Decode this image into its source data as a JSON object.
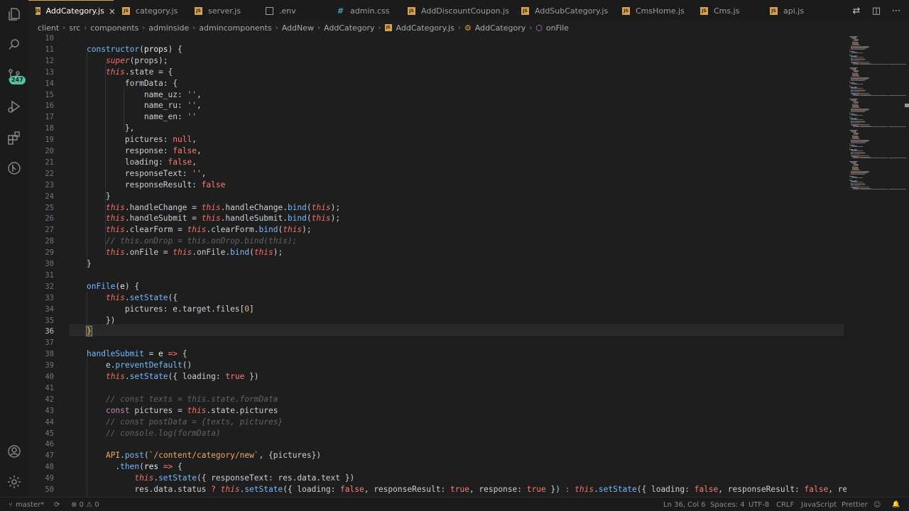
{
  "tabs": [
    {
      "label": "AddCategory.js",
      "type": "js",
      "active": true,
      "close": "×"
    },
    {
      "label": "category.js",
      "type": "js"
    },
    {
      "label": "server.js",
      "type": "js"
    },
    {
      "label": ".env",
      "type": "env"
    },
    {
      "label": "admin.css",
      "type": "css"
    },
    {
      "label": "AddDiscountCoupon.js",
      "type": "js"
    },
    {
      "label": "AddSubCategory.js",
      "type": "js"
    },
    {
      "label": "CmsHome.js",
      "type": "js"
    },
    {
      "label": "Cms.js",
      "type": "js"
    },
    {
      "label": "api.js",
      "type": "js"
    }
  ],
  "breadcrumb": [
    "client",
    "src",
    "components",
    "adminside",
    "admincomponents",
    "AddNew",
    "AddCategory",
    "AddCategory.js",
    "AddCategory",
    "onFile"
  ],
  "activity": {
    "scm_badge": "247"
  },
  "line_numbers": [
    "10",
    "11",
    "12",
    "13",
    "14",
    "15",
    "16",
    "17",
    "18",
    "19",
    "20",
    "21",
    "22",
    "23",
    "24",
    "25",
    "26",
    "27",
    "28",
    "29",
    "30",
    "31",
    "32",
    "33",
    "34",
    "35",
    "36",
    "37",
    "38",
    "39",
    "40",
    "41",
    "42",
    "43",
    "44",
    "45",
    "46",
    "47",
    "48",
    "49",
    "50"
  ],
  "code_lines": [
    [],
    [
      [
        "fn",
        "constructor"
      ],
      [
        "pn",
        "("
      ],
      [
        "va",
        "props"
      ],
      [
        "pn",
        ") {"
      ]
    ],
    [
      [
        "pn",
        "    "
      ],
      [
        "sup",
        "super"
      ],
      [
        "pn",
        "(props);"
      ]
    ],
    [
      [
        "pn",
        "    "
      ],
      [
        "th",
        "this"
      ],
      [
        "pn",
        ".state = {"
      ]
    ],
    [
      [
        "pn",
        "        formData: {"
      ]
    ],
    [
      [
        "pn",
        "            name_uz: "
      ],
      [
        "st",
        "''"
      ],
      [
        "pn",
        ","
      ]
    ],
    [
      [
        "pn",
        "            name_ru: "
      ],
      [
        "st",
        "''"
      ],
      [
        "pn",
        ","
      ]
    ],
    [
      [
        "pn",
        "            name_en: "
      ],
      [
        "st",
        "''"
      ]
    ],
    [
      [
        "pn",
        "        },"
      ]
    ],
    [
      [
        "pn",
        "        pictures: "
      ],
      [
        "bo",
        "null"
      ],
      [
        "pn",
        ","
      ]
    ],
    [
      [
        "pn",
        "        response: "
      ],
      [
        "bo",
        "false"
      ],
      [
        "pn",
        ","
      ]
    ],
    [
      [
        "pn",
        "        loading: "
      ],
      [
        "bo",
        "false"
      ],
      [
        "pn",
        ","
      ]
    ],
    [
      [
        "pn",
        "        responseText: "
      ],
      [
        "st",
        "''"
      ],
      [
        "pn",
        ","
      ]
    ],
    [
      [
        "pn",
        "        responseResult: "
      ],
      [
        "bo",
        "false"
      ]
    ],
    [
      [
        "pn",
        "    }"
      ]
    ],
    [
      [
        "pn",
        "    "
      ],
      [
        "th",
        "this"
      ],
      [
        "pn",
        ".handleChange = "
      ],
      [
        "th",
        "this"
      ],
      [
        "pn",
        ".handleChange."
      ],
      [
        "fn",
        "bind"
      ],
      [
        "pn",
        "("
      ],
      [
        "th",
        "this"
      ],
      [
        "pn",
        ");"
      ]
    ],
    [
      [
        "pn",
        "    "
      ],
      [
        "th",
        "this"
      ],
      [
        "pn",
        ".handleSubmit = "
      ],
      [
        "th",
        "this"
      ],
      [
        "pn",
        ".handleSubmit."
      ],
      [
        "fn",
        "bind"
      ],
      [
        "pn",
        "("
      ],
      [
        "th",
        "this"
      ],
      [
        "pn",
        ");"
      ]
    ],
    [
      [
        "pn",
        "    "
      ],
      [
        "th",
        "this"
      ],
      [
        "pn",
        ".clearForm = "
      ],
      [
        "th",
        "this"
      ],
      [
        "pn",
        ".clearForm."
      ],
      [
        "fn",
        "bind"
      ],
      [
        "pn",
        "("
      ],
      [
        "th",
        "this"
      ],
      [
        "pn",
        ");"
      ]
    ],
    [
      [
        "pn",
        "    "
      ],
      [
        "cm",
        "// this.onDrop = this.onDrop.bind(this);"
      ]
    ],
    [
      [
        "pn",
        "    "
      ],
      [
        "th",
        "this"
      ],
      [
        "pn",
        ".onFile = "
      ],
      [
        "th",
        "this"
      ],
      [
        "pn",
        ".onFile."
      ],
      [
        "fn",
        "bind"
      ],
      [
        "pn",
        "("
      ],
      [
        "th",
        "this"
      ],
      [
        "pn",
        ");"
      ]
    ],
    [
      [
        "pn",
        "}"
      ]
    ],
    [],
    [
      [
        "fn",
        "onFile"
      ],
      [
        "pn",
        "("
      ],
      [
        "va",
        "e"
      ],
      [
        "pn",
        ") {"
      ]
    ],
    [
      [
        "pn",
        "    "
      ],
      [
        "th",
        "this"
      ],
      [
        "pn",
        "."
      ],
      [
        "fn",
        "setState"
      ],
      [
        "pn",
        "({"
      ]
    ],
    [
      [
        "pn",
        "        pictures: e.target.files["
      ],
      [
        "nm",
        "0"
      ],
      [
        "pn",
        "]"
      ]
    ],
    [
      [
        "pn",
        "    })"
      ]
    ],
    [
      [
        "cursor",
        "}"
      ]
    ],
    [],
    [
      [
        "fn",
        "handleSubmit"
      ],
      [
        "pn",
        " = "
      ],
      [
        "va",
        "e"
      ],
      [
        "op",
        " =>"
      ],
      [
        "pn",
        " {"
      ]
    ],
    [
      [
        "pn",
        "    e."
      ],
      [
        "fn",
        "preventDefault"
      ],
      [
        "pn",
        "()"
      ]
    ],
    [
      [
        "pn",
        "    "
      ],
      [
        "th",
        "this"
      ],
      [
        "pn",
        "."
      ],
      [
        "fn",
        "setState"
      ],
      [
        "pn",
        "({ loading: "
      ],
      [
        "bo",
        "true"
      ],
      [
        "pn",
        " })"
      ]
    ],
    [],
    [
      [
        "pn",
        "    "
      ],
      [
        "cm",
        "// const texts = this.state.formData"
      ]
    ],
    [
      [
        "pn",
        "    "
      ],
      [
        "k",
        "const"
      ],
      [
        "pn",
        " pictures = "
      ],
      [
        "th",
        "this"
      ],
      [
        "pn",
        ".state.pictures"
      ]
    ],
    [
      [
        "pn",
        "    "
      ],
      [
        "cm",
        "// const postData = {texts, pictures}"
      ]
    ],
    [
      [
        "pn",
        "    "
      ],
      [
        "cm",
        "// console.log(formData)"
      ]
    ],
    [],
    [
      [
        "pn",
        "    "
      ],
      [
        "st",
        "API"
      ],
      [
        "pn",
        "."
      ],
      [
        "fn",
        "post"
      ],
      [
        "pn",
        "("
      ],
      [
        "st",
        "`/content/category/new`"
      ],
      [
        "pn",
        ", {pictures})"
      ]
    ],
    [
      [
        "pn",
        "      ."
      ],
      [
        "fn",
        "then"
      ],
      [
        "pn",
        "("
      ],
      [
        "va",
        "res"
      ],
      [
        "op",
        " =>"
      ],
      [
        "pn",
        " {"
      ]
    ],
    [
      [
        "pn",
        "          "
      ],
      [
        "th",
        "this"
      ],
      [
        "pn",
        "."
      ],
      [
        "fn",
        "setState"
      ],
      [
        "pn",
        "({ responseText: res.data.text })"
      ]
    ],
    [
      [
        "pn",
        "          res.data.status "
      ],
      [
        "op",
        "?"
      ],
      [
        "pn",
        " "
      ],
      [
        "th",
        "this"
      ],
      [
        "pn",
        "."
      ],
      [
        "fn",
        "setState"
      ],
      [
        "pn",
        "({ loading: "
      ],
      [
        "bo",
        "false"
      ],
      [
        "pn",
        ", responseResult: "
      ],
      [
        "bo",
        "true"
      ],
      [
        "pn",
        ", response: "
      ],
      [
        "bo",
        "true"
      ],
      [
        "pn",
        " }) "
      ],
      [
        "op",
        ":"
      ],
      [
        "pn",
        " "
      ],
      [
        "th",
        "this"
      ],
      [
        "pn",
        "."
      ],
      [
        "fn",
        "setState"
      ],
      [
        "pn",
        "({ loading: "
      ],
      [
        "bo",
        "false"
      ],
      [
        "pn",
        ", responseResult: "
      ],
      [
        "bo",
        "false"
      ],
      [
        "pn",
        ", respons"
      ]
    ]
  ],
  "status": {
    "branch": "master*",
    "problems": "⊗ 0 ⚠ 0",
    "position": "Ln 36, Col 6",
    "spaces": "Spaces: 4",
    "encoding": "UTF-8",
    "eol": "CRLF",
    "language": "JavaScript",
    "formatter": "Prettier",
    "bell": "🔔"
  },
  "colors": {
    "accent": "#d4a84b",
    "badge": "#4fc1a6",
    "background": "#1e1e1e"
  }
}
